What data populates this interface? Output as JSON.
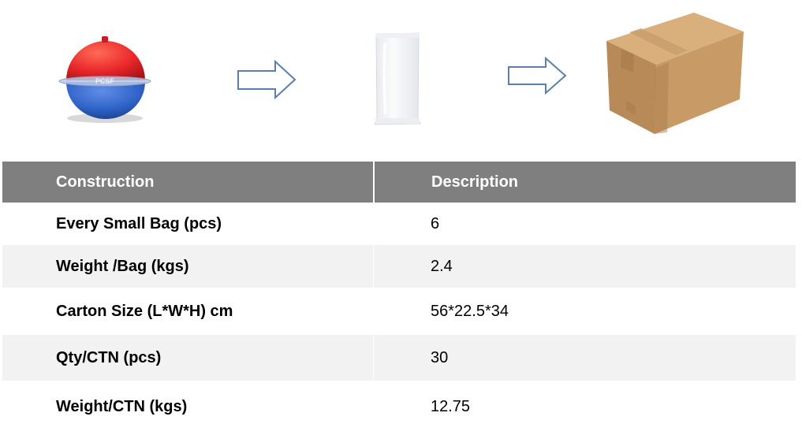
{
  "packaging_flow": {
    "steps": [
      {
        "icon": "marker-ball-icon"
      },
      {
        "icon": "arrow-right-icon"
      },
      {
        "icon": "plastic-bag-icon"
      },
      {
        "icon": "arrow-right-icon"
      },
      {
        "icon": "carton-box-icon"
      }
    ],
    "colors": {
      "ball_red": "#e8262a",
      "ball_blue": "#2f63c8",
      "arrow_outline": "#5b7fa8",
      "box_brown": "#c89a66"
    }
  },
  "table": {
    "headers": [
      "Construction",
      "Description"
    ],
    "header_bg": "#7f7f7f",
    "rows": [
      {
        "label": "Every Small Bag (pcs)",
        "value": "6"
      },
      {
        "label": "Weight /Bag (kgs)",
        "value": "2.4"
      },
      {
        "label": "Carton Size (L*W*H) cm",
        "value": "56*22.5*34"
      },
      {
        "label": "Qty/CTN (pcs)",
        "value": "30"
      },
      {
        "label": "Weight/CTN (kgs)",
        "value": "12.75"
      }
    ]
  }
}
